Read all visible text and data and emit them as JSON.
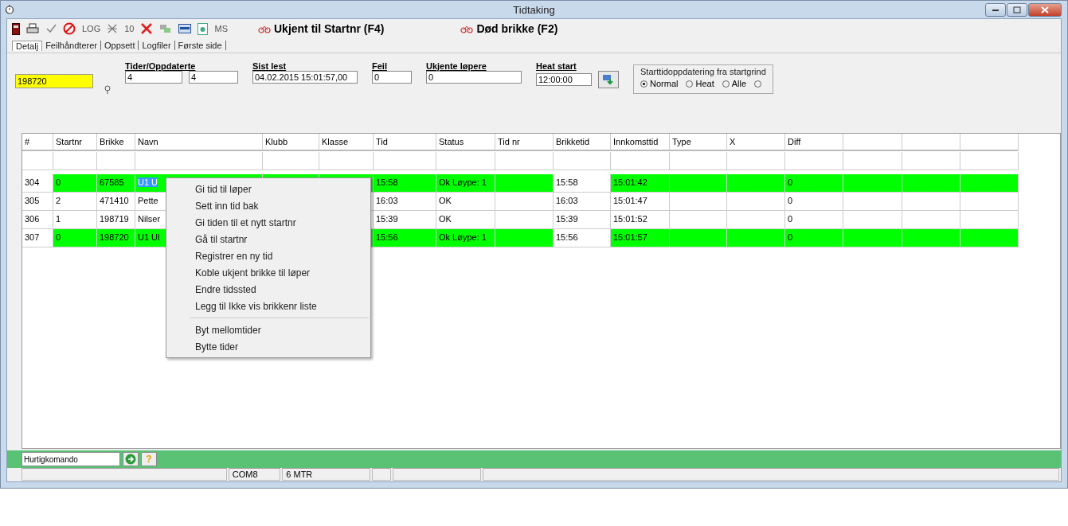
{
  "window": {
    "title": "Tidtaking"
  },
  "toolbar": {
    "texts": [
      "LOG",
      "10",
      "MS"
    ],
    "buttons": [
      {
        "label": "Ukjent til Startnr (F4)"
      },
      {
        "label": "Død brikke (F2)"
      }
    ]
  },
  "tabs": [
    {
      "label": "Detalj",
      "selected": true
    },
    {
      "label": "Feilhåndterer",
      "selected": false
    },
    {
      "label": "Oppsett",
      "selected": false
    },
    {
      "label": "Logfiler",
      "selected": false
    },
    {
      "label": "Første side",
      "selected": false
    }
  ],
  "search": {
    "value": "198720"
  },
  "fields": [
    {
      "label": "Tider/Oppdaterte",
      "values": [
        "4",
        "4"
      ]
    },
    {
      "label": "Sist lest",
      "values": [
        "04.02.2015 15:01:57,00"
      ]
    },
    {
      "label": "Feil",
      "values": [
        "0"
      ]
    },
    {
      "label": "Ukjente løpere",
      "values": [
        "0"
      ]
    },
    {
      "label": "Heat start",
      "values": [
        "12:00:00"
      ]
    }
  ],
  "start_update": {
    "title": "Starttidoppdatering fra startgrind",
    "options": [
      {
        "label": "Normal",
        "selected": true
      },
      {
        "label": "Heat",
        "selected": false
      },
      {
        "label": "Alle",
        "selected": false
      },
      {
        "selected": false
      }
    ]
  },
  "table": {
    "columns": [
      {
        "label": "#",
        "tinted": false
      },
      {
        "label": "Startnr",
        "tinted": true
      },
      {
        "label": "Brikke",
        "tinted": true
      },
      {
        "label": "Navn",
        "tinted": true
      },
      {
        "label": "Klubb",
        "tinted": true
      },
      {
        "label": "Klasse",
        "tinted": true
      },
      {
        "label": "Tid",
        "tinted": true
      },
      {
        "label": "Status",
        "tinted": true
      },
      {
        "label": "Tid nr",
        "tinted": true
      },
      {
        "label": "Brikketid",
        "tinted": false
      },
      {
        "label": "Innkomsttid",
        "tinted": true
      },
      {
        "label": "Type",
        "tinted": true
      },
      {
        "label": "X",
        "tinted": true
      },
      {
        "label": "Diff",
        "tinted": true
      },
      {
        "tinted": true
      },
      {
        "tinted": true
      },
      {
        "tinted": true
      }
    ],
    "rows": [
      {
        "ok": true,
        "selected": true,
        "cells": [
          "304",
          "0",
          "67585",
          "U1 U",
          null,
          null,
          "15:58",
          "Ok Løype: 1",
          null,
          "15:58",
          "15:01:42",
          null,
          null,
          "0",
          null,
          null,
          null
        ]
      },
      {
        "ok": false,
        "selected": false,
        "cells": [
          "305",
          "2",
          "471410",
          "Pette",
          null,
          null,
          "16:03",
          "OK",
          null,
          "16:03",
          "15:01:47",
          null,
          null,
          "0",
          null,
          null,
          null
        ]
      },
      {
        "ok": false,
        "selected": false,
        "cells": [
          "306",
          "1",
          "198719",
          "Nilser",
          null,
          null,
          "15:39",
          "OK",
          null,
          "15:39",
          "15:01:52",
          null,
          null,
          "0",
          null,
          null,
          null
        ]
      },
      {
        "ok": true,
        "selected": false,
        "cells": [
          "307",
          "0",
          "198720",
          "U1 Ul",
          null,
          null,
          "15:56",
          "Ok Løype: 1",
          null,
          "15:56",
          "15:01:57",
          null,
          null,
          "0",
          null,
          null,
          null
        ]
      }
    ]
  },
  "context_menu": [
    {
      "kind": "item",
      "label": "Gi tid til løper"
    },
    {
      "kind": "item",
      "label": "Sett inn tid bak"
    },
    {
      "kind": "item",
      "label": "Gi tiden til et nytt startnr"
    },
    {
      "kind": "item",
      "label": "Gå til startnr"
    },
    {
      "kind": "item",
      "label": "Registrer en ny tid"
    },
    {
      "kind": "item",
      "label": "Koble ukjent brikke til løper"
    },
    {
      "kind": "item",
      "label": "Endre tidssted"
    },
    {
      "kind": "item",
      "label": "Legg til Ikke vis brikkenr liste"
    },
    {
      "kind": "separator"
    },
    {
      "kind": "item",
      "label": "Byt mellomtider"
    },
    {
      "kind": "item",
      "label": "Bytte tider"
    }
  ],
  "command": {
    "value": "Hurtigkomando",
    "help": "?"
  },
  "status_bar": {
    "panes": [
      "COM8",
      "6 MTR"
    ]
  }
}
